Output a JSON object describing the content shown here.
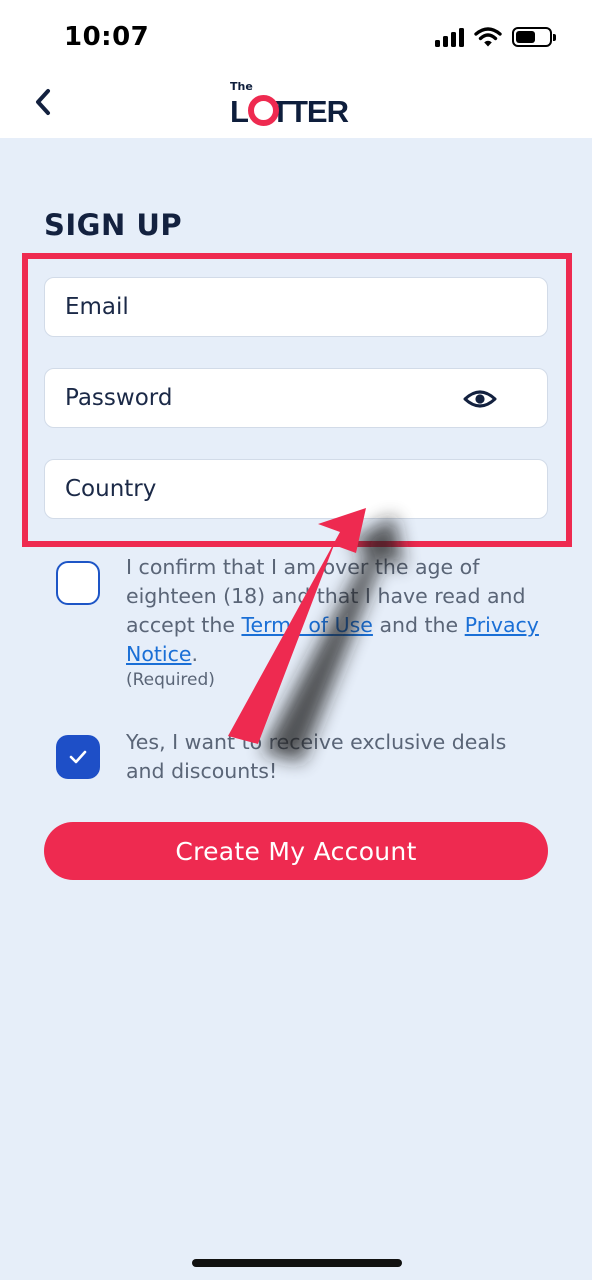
{
  "status_bar": {
    "time": "10:07",
    "icons": [
      "cellular-signal-icon",
      "wifi-icon",
      "battery-icon"
    ]
  },
  "header": {
    "back_icon": "chevron-left-icon",
    "logo_small": "The",
    "logo_text": "LOTTER"
  },
  "form": {
    "title": "SIGN UP",
    "email_label": "Email",
    "password_label": "Password",
    "password_toggle_icon": "eye-icon",
    "country_label": "Country"
  },
  "consent": {
    "age_text_before": "I confirm that I am over the age of eighteen (18) and that I have read and accept the ",
    "terms_link": "Terms of Use",
    "age_text_middle": " and the ",
    "privacy_link": "Privacy Notice",
    "age_text_after": ".",
    "required_note": "(Required)",
    "age_checked": false,
    "marketing_text": "Yes, I want to receive exclusive deals and discounts!",
    "marketing_checked": true
  },
  "actions": {
    "create_account_label": "Create My Account"
  },
  "colors": {
    "brand_red": "#ee2a50",
    "navy": "#13213f",
    "link_blue": "#1a6fd6",
    "checkbox_blue": "#1e4fc7",
    "background": "#e6eef9"
  }
}
